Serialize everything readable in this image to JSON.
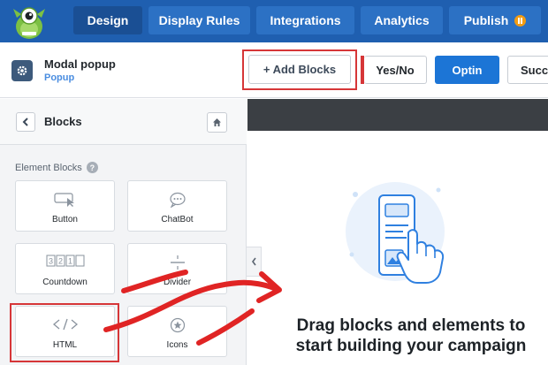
{
  "nav": {
    "tabs": [
      {
        "label": "Design",
        "active": true
      },
      {
        "label": "Display Rules",
        "active": false
      },
      {
        "label": "Integrations",
        "active": false
      },
      {
        "label": "Analytics",
        "active": false
      },
      {
        "label": "Publish",
        "active": false,
        "badge": "pause"
      }
    ]
  },
  "campaign": {
    "title": "Modal popup",
    "subtitle": "Popup",
    "add_blocks_label": "+ Add Blocks",
    "views": [
      "Yes/No",
      "Optin",
      "Succe"
    ]
  },
  "sidebar": {
    "title": "Blocks",
    "section_label": "Element Blocks",
    "help_glyph": "?",
    "blocks": [
      {
        "label": "Button",
        "icon": "button-cursor-icon"
      },
      {
        "label": "ChatBot",
        "icon": "chat-bubble-icon"
      },
      {
        "label": "Countdown",
        "icon": "countdown-digits-icon"
      },
      {
        "label": "Divider",
        "icon": "divider-icon"
      },
      {
        "label": "HTML",
        "icon": "code-icon",
        "highlighted": true
      },
      {
        "label": "Icons",
        "icon": "star-circle-icon"
      }
    ]
  },
  "canvas": {
    "empty_message_line1": "Drag blocks and elements to",
    "empty_message_line2": "start building your campaign"
  },
  "colors": {
    "nav_bg": "#1f5fb0",
    "nav_active": "#1a4f94",
    "primary": "#1c75d6",
    "highlight_red": "#d63638",
    "badge_orange": "#f39c12"
  }
}
